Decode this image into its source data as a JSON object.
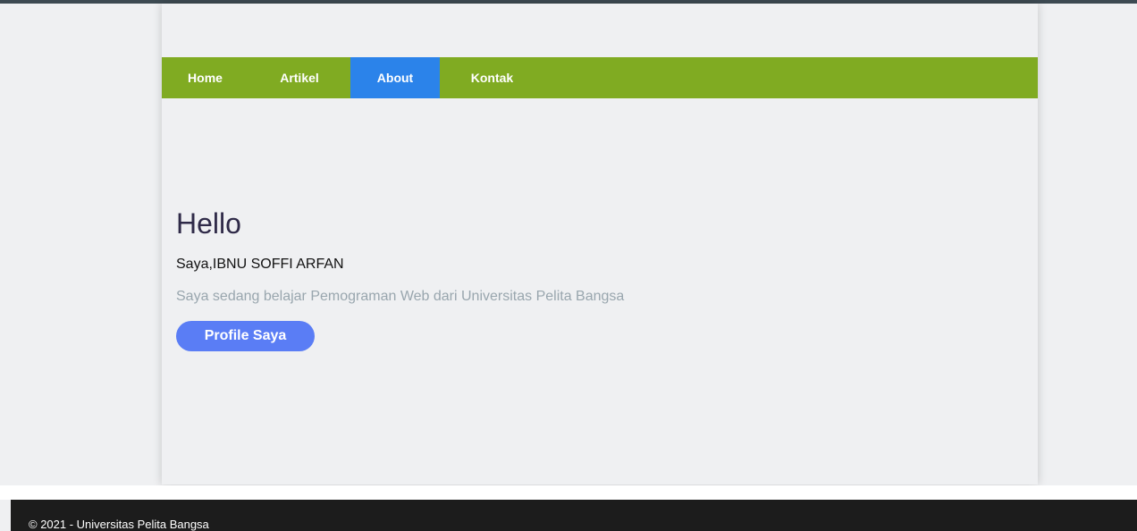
{
  "nav": {
    "items": [
      {
        "label": "Home"
      },
      {
        "label": "Artikel"
      },
      {
        "label": "About"
      },
      {
        "label": "Kontak"
      }
    ],
    "active": "About",
    "colors": {
      "bar": "#80ab22",
      "active": "#2b83ea"
    }
  },
  "hero": {
    "heading": "Hello",
    "intro": "Saya,IBNU SOFFI ARFAN",
    "subtitle": "Saya sedang belajar Pemograman Web dari Universitas Pelita Bangsa",
    "button_label": "Profile Saya",
    "button_color": "#5a7df5"
  },
  "footer": {
    "text": "© 2021 - Universitas Pelita Bangsa"
  }
}
